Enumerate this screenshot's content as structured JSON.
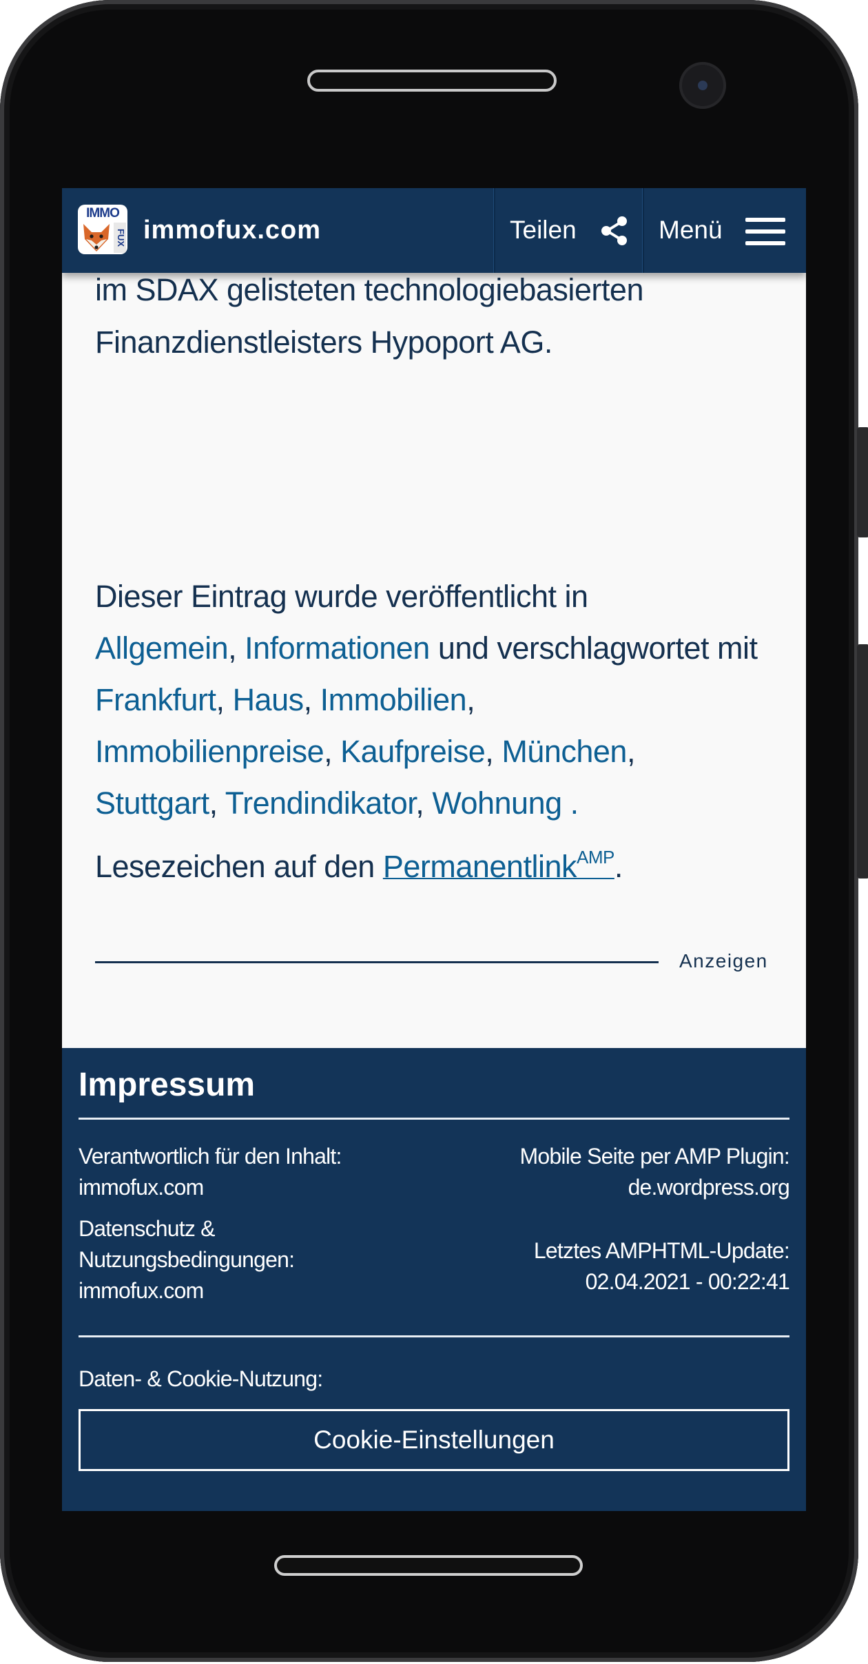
{
  "header": {
    "logo_text": "IMMO",
    "logo_side_text": "FUX",
    "site_name": "immofux.com",
    "share_label": "Teilen",
    "menu_label": "Menü"
  },
  "article": {
    "intro_line1": "im SDAX gelisteten technologiebasierten",
    "intro_line2": "Finanzdienstleisters Hypoport AG.",
    "meta_prefix": "Dieser Eintrag wurde veröffentlicht in",
    "categories": [
      "Allgemein",
      "Informationen"
    ],
    "meta_middle": "und verschlagwortet mit",
    "tags": [
      "Frankfurt",
      "Haus",
      "Immobilien",
      "Immobilienpreise",
      "Kaufpreise",
      "München",
      "Stuttgart",
      "Trendindikator",
      "Wohnung"
    ],
    "bookmark_prefix": "Lesezeichen auf den",
    "permalink_label": "Permanentlink",
    "permalink_sup": "AMP",
    "ads_label": "Anzeigen"
  },
  "footer": {
    "title": "Impressum",
    "responsible_label": "Verantwortlich für den Inhalt:",
    "responsible_value": "immofux.com",
    "privacy_label_1": "Datenschutz &",
    "privacy_label_2": "Nutzungsbedingungen:",
    "privacy_value": "immofux.com",
    "amp_label": "Mobile Seite per AMP Plugin:",
    "amp_value": "de.wordpress.org",
    "update_label": "Letztes AMPHTML-Update:",
    "update_value": "02.04.2021 - 00:22:41",
    "cookie_label": "Daten- & Cookie-Nutzung:",
    "cookie_button": "Cookie-Einstellungen"
  },
  "colors": {
    "header_bg": "#133458",
    "link": "#0d5f93",
    "text": "#14304f",
    "page_bg": "#f9f9f9"
  },
  "icons": [
    "share-icon",
    "hamburger-menu-icon",
    "fox-logo-icon"
  ]
}
